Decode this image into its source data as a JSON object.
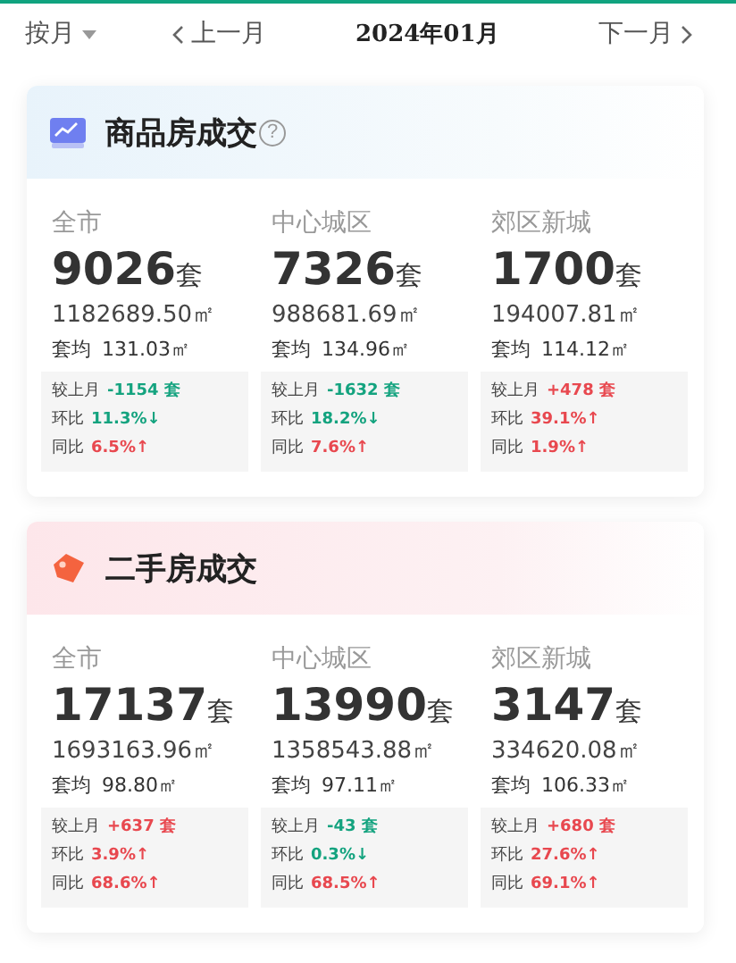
{
  "toolbar": {
    "period": "按月",
    "prev": "上一月",
    "current": "2024年01月",
    "next": "下一月"
  },
  "sections": [
    {
      "kind": "new",
      "title": "商品房成交",
      "help": "?",
      "regions": [
        {
          "name": "全市",
          "count": "9026",
          "unit": "套",
          "area": "1182689.50㎡",
          "avg_label": "套均",
          "avg": "131.03㎡",
          "stats": [
            {
              "label": "较上月",
              "value": "-1154 套",
              "color": "#14a37f"
            },
            {
              "label": "环比",
              "value": "11.3%↓",
              "color": "#14a37f"
            },
            {
              "label": "同比",
              "value": "6.5%↑",
              "color": "#e8484f"
            }
          ]
        },
        {
          "name": "中心城区",
          "count": "7326",
          "unit": "套",
          "area": "988681.69㎡",
          "avg_label": "套均",
          "avg": "134.96㎡",
          "stats": [
            {
              "label": "较上月",
              "value": "-1632 套",
              "color": "#14a37f"
            },
            {
              "label": "环比",
              "value": "18.2%↓",
              "color": "#14a37f"
            },
            {
              "label": "同比",
              "value": "7.6%↑",
              "color": "#e8484f"
            }
          ]
        },
        {
          "name": "郊区新城",
          "count": "1700",
          "unit": "套",
          "area": "194007.81㎡",
          "avg_label": "套均",
          "avg": "114.12㎡",
          "stats": [
            {
              "label": "较上月",
              "value": "+478 套",
              "color": "#e8484f"
            },
            {
              "label": "环比",
              "value": "39.1%↑",
              "color": "#e8484f"
            },
            {
              "label": "同比",
              "value": "1.9%↑",
              "color": "#e8484f"
            }
          ]
        }
      ]
    },
    {
      "kind": "resale",
      "title": "二手房成交",
      "regions": [
        {
          "name": "全市",
          "count": "17137",
          "unit": "套",
          "area": "1693163.96㎡",
          "avg_label": "套均",
          "avg": "98.80㎡",
          "stats": [
            {
              "label": "较上月",
              "value": "+637 套",
              "color": "#e8484f"
            },
            {
              "label": "环比",
              "value": "3.9%↑",
              "color": "#e8484f"
            },
            {
              "label": "同比",
              "value": "68.6%↑",
              "color": "#e8484f"
            }
          ]
        },
        {
          "name": "中心城区",
          "count": "13990",
          "unit": "套",
          "area": "1358543.88㎡",
          "avg_label": "套均",
          "avg": "97.11㎡",
          "stats": [
            {
              "label": "较上月",
              "value": "-43 套",
              "color": "#14a37f"
            },
            {
              "label": "环比",
              "value": "0.3%↓",
              "color": "#14a37f"
            },
            {
              "label": "同比",
              "value": "68.5%↑",
              "color": "#e8484f"
            }
          ]
        },
        {
          "name": "郊区新城",
          "count": "3147",
          "unit": "套",
          "area": "334620.08㎡",
          "avg_label": "套均",
          "avg": "106.33㎡",
          "stats": [
            {
              "label": "较上月",
              "value": "+680 套",
              "color": "#e8484f"
            },
            {
              "label": "环比",
              "value": "27.6%↑",
              "color": "#e8484f"
            },
            {
              "label": "同比",
              "value": "69.1%↑",
              "color": "#e8484f"
            }
          ]
        }
      ]
    }
  ]
}
